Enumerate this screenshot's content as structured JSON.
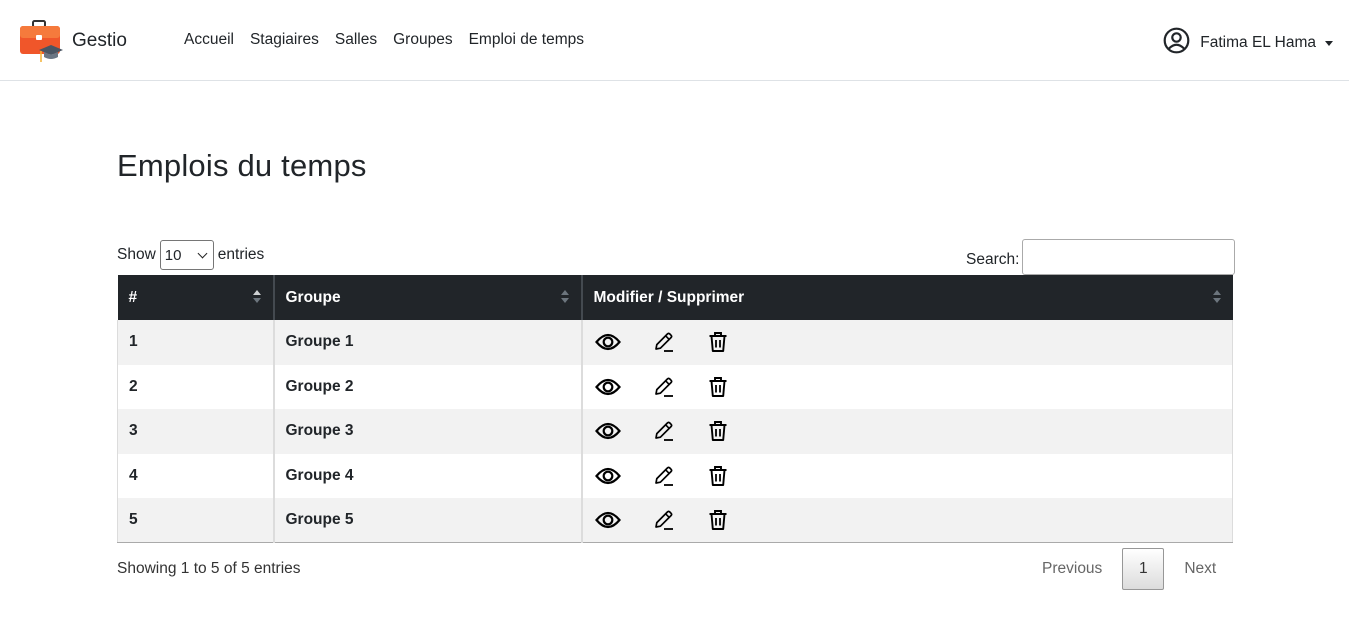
{
  "navbar": {
    "brand": "Gestio",
    "links": [
      "Accueil",
      "Stagiaires",
      "Salles",
      "Groupes",
      "Emploi de temps"
    ],
    "user": "Fatima EL Hama"
  },
  "page": {
    "title": "Emplois du temps"
  },
  "length": {
    "show": "Show",
    "value": "10",
    "entries": "entries"
  },
  "search": {
    "label": "Search:",
    "value": ""
  },
  "table": {
    "headers": [
      "#",
      "Groupe",
      "Modifier / Supprimer"
    ],
    "rows": [
      {
        "num": "1",
        "groupe": "Groupe 1"
      },
      {
        "num": "2",
        "groupe": "Groupe 2"
      },
      {
        "num": "3",
        "groupe": "Groupe 3"
      },
      {
        "num": "4",
        "groupe": "Groupe 4"
      },
      {
        "num": "5",
        "groupe": "Groupe 5"
      }
    ]
  },
  "footer": {
    "info": "Showing 1 to 5 of 5 entries",
    "previous": "Previous",
    "current": "1",
    "next": "Next"
  },
  "icons": {
    "actions": [
      "eye-icon",
      "pencil-icon",
      "trash-icon"
    ],
    "brand": "briefcase-graduation-icon",
    "user": "user-circle-icon"
  },
  "colors": {
    "header_bg": "#212529",
    "brand_orange": "#f0562a",
    "row_stripe": "#f2f2f2"
  }
}
